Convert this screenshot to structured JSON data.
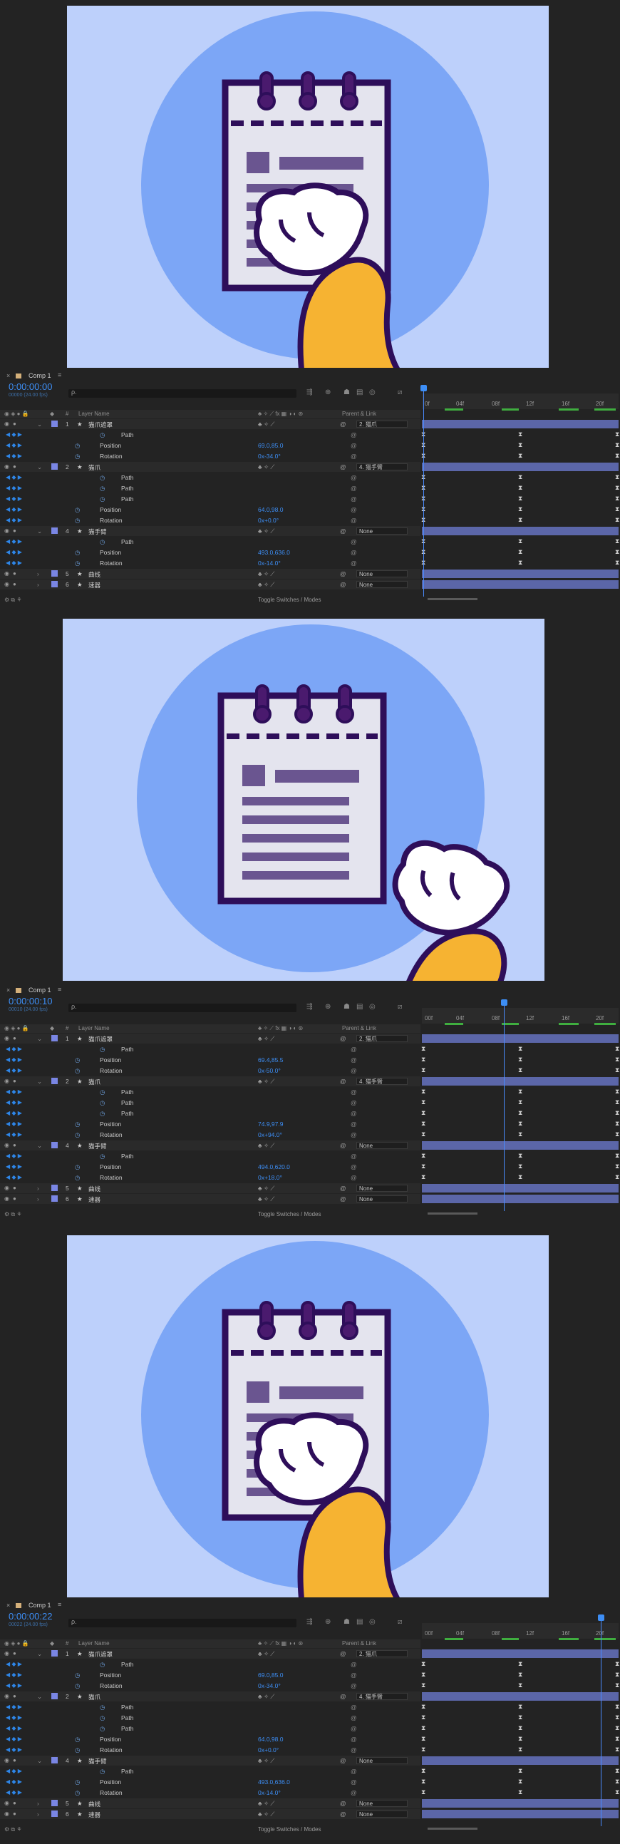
{
  "frames": [
    {
      "comp_tab": "Comp 1",
      "timecode": "0:00:00:00",
      "fps_label": "00000 (24.00 fps)",
      "search_placeholder": "ρ.",
      "columns": {
        "layer_name": "Layer Name",
        "parent": "Parent & Link"
      },
      "ruler": [
        "0f",
        "04f",
        "08f",
        "12f",
        "16f",
        "20f"
      ],
      "playhead_frame": 0,
      "layers": [
        {
          "num": "1",
          "name": "猫爪遮罩",
          "parent": "2. 猫爪"
        },
        {
          "prop": "Path"
        },
        {
          "prop": "Position",
          "value": "69.0,85.0"
        },
        {
          "prop": "Rotation",
          "value": "0x-34.0°"
        },
        {
          "num": "2",
          "name": "猫爪",
          "parent": "4. 猫手臂"
        },
        {
          "prop": "Path"
        },
        {
          "prop": "Path"
        },
        {
          "prop": "Path"
        },
        {
          "prop": "Position",
          "value": "64.0,98.0"
        },
        {
          "prop": "Rotation",
          "value": "0x+0.0°"
        },
        {
          "num": "4",
          "name": "猫手臂",
          "parent": "None"
        },
        {
          "prop": "Path"
        },
        {
          "prop": "Position",
          "value": "493.0,636.0"
        },
        {
          "prop": "Rotation",
          "value": "0x-14.0°"
        },
        {
          "num": "5",
          "name": "曲线",
          "parent": "None"
        },
        {
          "num": "6",
          "name": "速器",
          "parent": "None"
        }
      ],
      "footer": "Toggle Switches / Modes"
    },
    {
      "comp_tab": "Comp 1",
      "timecode": "0:00:00:10",
      "fps_label": "00010 (24.00 fps)",
      "search_placeholder": "ρ.",
      "columns": {
        "layer_name": "Layer Name",
        "parent": "Parent & Link"
      },
      "ruler": [
        "00f",
        "04f",
        "08f",
        "12f",
        "16f",
        "20f"
      ],
      "playhead_frame": 10,
      "layers": [
        {
          "num": "1",
          "name": "猫爪遮罩",
          "parent": "2. 猫爪"
        },
        {
          "prop": "Path"
        },
        {
          "prop": "Position",
          "value": "69.4,85.5"
        },
        {
          "prop": "Rotation",
          "value": "0x-50.0°"
        },
        {
          "num": "2",
          "name": "猫爪",
          "parent": "4. 猫手臂"
        },
        {
          "prop": "Path"
        },
        {
          "prop": "Path"
        },
        {
          "prop": "Path"
        },
        {
          "prop": "Position",
          "value": "74.9,97.9"
        },
        {
          "prop": "Rotation",
          "value": "0x+94.0°"
        },
        {
          "num": "4",
          "name": "猫手臂",
          "parent": "None"
        },
        {
          "prop": "Path"
        },
        {
          "prop": "Position",
          "value": "494.0,620.0"
        },
        {
          "prop": "Rotation",
          "value": "0x+18.0°"
        },
        {
          "num": "5",
          "name": "曲线",
          "parent": "None"
        },
        {
          "num": "6",
          "name": "速器",
          "parent": "None"
        }
      ],
      "footer": "Toggle Switches / Modes"
    },
    {
      "comp_tab": "Comp 1",
      "timecode": "0:00:00:22",
      "fps_label": "00022 (24.00 fps)",
      "search_placeholder": "ρ.",
      "columns": {
        "layer_name": "Layer Name",
        "parent": "Parent & Link"
      },
      "ruler": [
        "00f",
        "04f",
        "08f",
        "12f",
        "16f",
        "20f"
      ],
      "playhead_frame": 22,
      "layers": [
        {
          "num": "1",
          "name": "猫爪遮罩",
          "parent": "2. 猫爪"
        },
        {
          "prop": "Path"
        },
        {
          "prop": "Position",
          "value": "69.0,85.0"
        },
        {
          "prop": "Rotation",
          "value": "0x-34.0°"
        },
        {
          "num": "2",
          "name": "猫爪",
          "parent": "4. 猫手臂"
        },
        {
          "prop": "Path"
        },
        {
          "prop": "Path"
        },
        {
          "prop": "Path"
        },
        {
          "prop": "Position",
          "value": "64.0,98.0"
        },
        {
          "prop": "Rotation",
          "value": "0x+0.0°"
        },
        {
          "num": "4",
          "name": "猫手臂",
          "parent": "None"
        },
        {
          "prop": "Path"
        },
        {
          "prop": "Position",
          "value": "493.0,636.0"
        },
        {
          "prop": "Rotation",
          "value": "0x-14.0°"
        },
        {
          "num": "5",
          "name": "曲线",
          "parent": "None"
        },
        {
          "num": "6",
          "name": "速器",
          "parent": "None"
        }
      ],
      "footer": "Toggle Switches / Modes"
    }
  ],
  "colors": {
    "accent": "#3d8ef5",
    "layer_bar": "#5b66a8",
    "cat_arm": "#f6b332",
    "outline": "#2e0e5a",
    "circle": "#7ca6f6",
    "bg_canvas": "#bdd0fb"
  }
}
